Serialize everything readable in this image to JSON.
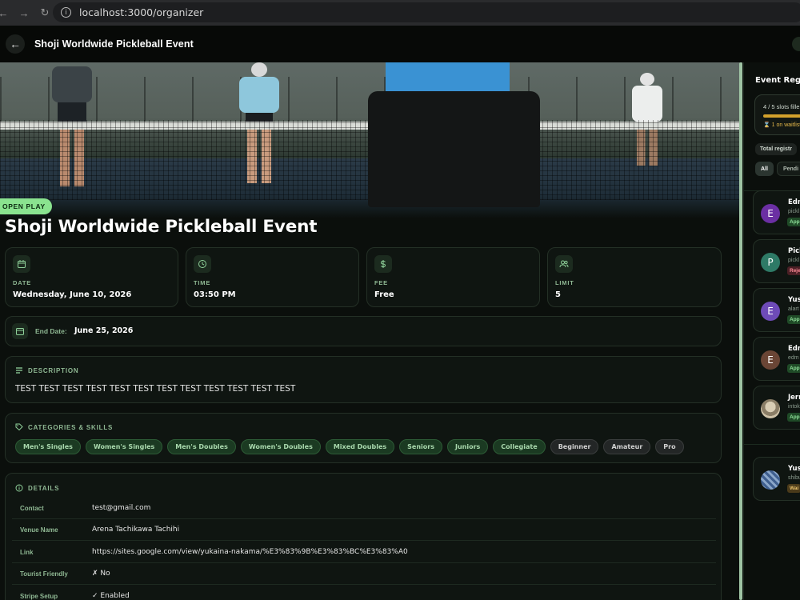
{
  "browser": {
    "url": "localhost:3000/organizer",
    "back_glyph": "←",
    "forward_glyph": "→",
    "reload_glyph": "↻",
    "info_glyph": "i"
  },
  "header": {
    "back_glyph": "←",
    "title": "Shoji Worldwide Pickleball Event"
  },
  "event": {
    "badge": "OPEN PLAY",
    "title": "Shoji Worldwide Pickleball Event",
    "stats": [
      {
        "icon": "calendar-icon",
        "label": "DATE",
        "value": "Wednesday, June 10, 2026"
      },
      {
        "icon": "clock-icon",
        "label": "TIME",
        "value": "03:50 PM"
      },
      {
        "icon": "dollar-icon",
        "label": "FEE",
        "value": "Free"
      },
      {
        "icon": "users-icon",
        "label": "LIMIT",
        "value": "5"
      }
    ],
    "end_date": {
      "label": "End Date:",
      "value": "June 25, 2026"
    },
    "description": {
      "heading": "DESCRIPTION",
      "text": "TEST TEST TEST TEST TEST TEST TEST TEST TEST TEST TEST TEST"
    },
    "categories": {
      "heading": "CATEGORIES & SKILLS",
      "items": [
        "Men's Singles",
        "Women's Singles",
        "Men's Doubles",
        "Women's Doubles",
        "Mixed Doubles",
        "Seniors",
        "Juniors",
        "Collegiate",
        "Beginner",
        "Amateur",
        "Pro"
      ]
    },
    "details": {
      "heading": "DETAILS",
      "rows": [
        {
          "key": "Contact",
          "value": "test@gmail.com"
        },
        {
          "key": "Venue Name",
          "value": "Arena Tachikawa Tachihi"
        },
        {
          "key": "Link",
          "value": "https://sites.google.com/view/yukaina-nakama/%E3%83%9B%E3%83%BC%E3%83%A0"
        },
        {
          "key": "Tourist Friendly",
          "value": "✗ No"
        },
        {
          "key": "Stripe Setup",
          "value": "✓ Enabled"
        }
      ]
    }
  },
  "sidebar": {
    "title": "Event Reg",
    "slots_text": "4 / 5 slots fille",
    "slots_fill_fraction": 0.8,
    "waitlist_text": "⌛ 1 on waitlist",
    "total_chip": "Total registr",
    "tabs": [
      "All",
      "Pendi"
    ],
    "registrants": [
      {
        "initial": "E",
        "name": "Edm",
        "sub": "pickl",
        "status": "App",
        "status_type": "app",
        "color": "#6b2fa3"
      },
      {
        "initial": "P",
        "name": "Pick",
        "sub": "pickl",
        "status": "Reje",
        "status_type": "rej",
        "color": "#2e7a66"
      },
      {
        "initial": "E",
        "name": "Yus",
        "sub": "alart",
        "status": "App",
        "status_type": "app",
        "color": "#6e4bb8"
      },
      {
        "initial": "E",
        "name": "Edm",
        "sub": "edm",
        "status": "App",
        "status_type": "app",
        "color": "#6a4535"
      },
      {
        "initial": "",
        "name": "Jerr",
        "sub": "intok",
        "status": "App",
        "status_type": "app",
        "color": "#cfc2a8"
      }
    ],
    "waitlisted": [
      {
        "initial": "",
        "name": "Yus",
        "sub": "shibu",
        "status": "Wai",
        "status_type": "wait",
        "color": "#5b7aa8"
      }
    ]
  }
}
